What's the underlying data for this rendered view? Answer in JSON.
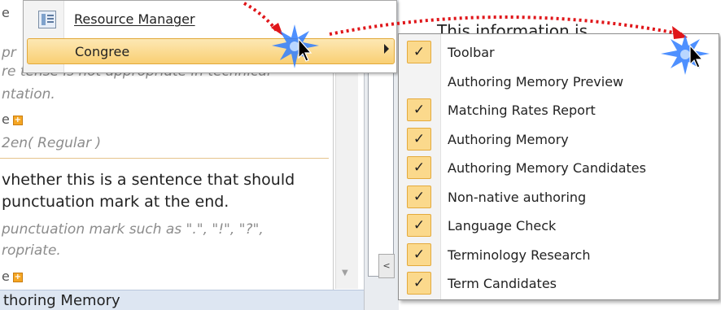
{
  "left_pane": {
    "frag_top_left": "e",
    "frag_italic_1": "pr",
    "frag_italic_2": "re tense is not appropriate in technical",
    "frag_italic_3": "ntation.",
    "frag_e_1": "e",
    "frag_italic_4": "2en( Regular )",
    "frag_main_1": "vhether this is a sentence that should",
    "frag_main_2": "punctuation mark at the end.",
    "frag_italic_5": "punctuation mark such as \".\", \"!\", \"?\",",
    "frag_italic_6": "ropriate.",
    "frag_e_2": "e"
  },
  "bottom_tab": {
    "label": "thoring Memory"
  },
  "right_area": {
    "text": "This information is                          "
  },
  "menu": {
    "resource_manager": "Resource Manager",
    "congree": "Congree"
  },
  "submenu": {
    "items": [
      {
        "label": "Toolbar",
        "checked": true
      },
      {
        "label": "Authoring Memory Preview",
        "checked": false
      },
      {
        "label": "Matching Rates Report",
        "checked": true
      },
      {
        "label": "Authoring Memory",
        "checked": true
      },
      {
        "label": "Authoring Memory Candidates",
        "checked": true
      },
      {
        "label": "Non-native authoring",
        "checked": true
      },
      {
        "label": "Language Check",
        "checked": true
      },
      {
        "label": "Terminology Research",
        "checked": true
      },
      {
        "label": "Term Candidates",
        "checked": true
      }
    ],
    "check_glyph": "✓"
  },
  "colors": {
    "highlight": "#f9cf73",
    "check_bg": "#fbd98c",
    "arrow_red": "#e0161a",
    "burst_blue": "#2f7cff"
  }
}
